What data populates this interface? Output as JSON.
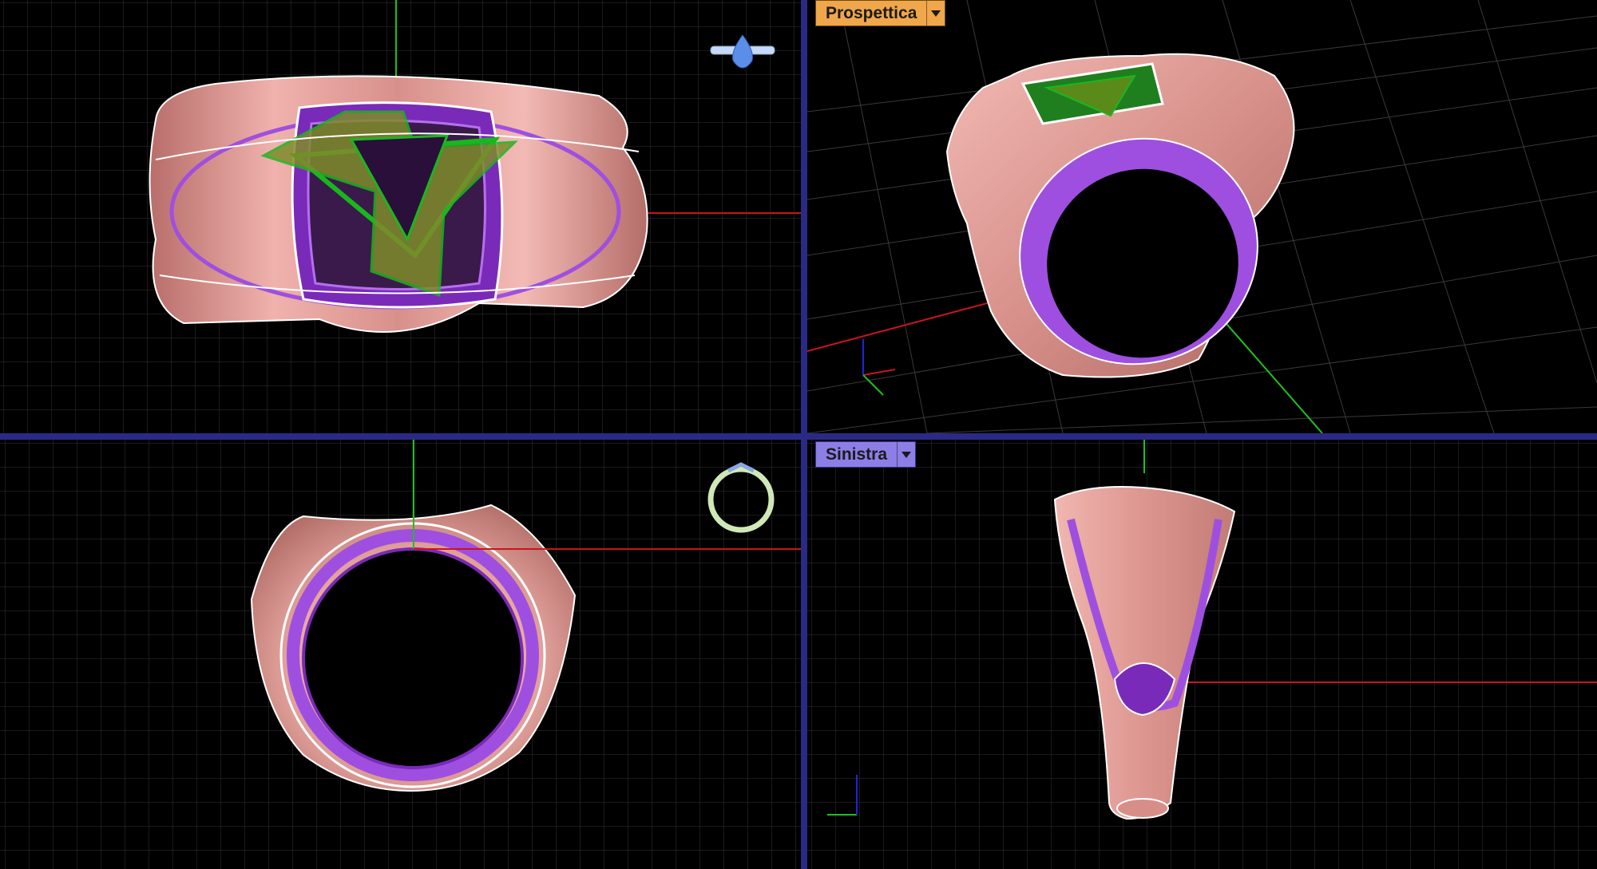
{
  "app": {
    "name": "Rhino 4-view viewport layout"
  },
  "viewports": {
    "top": {
      "title": "",
      "projection": "parallel"
    },
    "perspective": {
      "title": "Prospettica",
      "tab_color": "#f0a64a",
      "projection": "perspective"
    },
    "front": {
      "title": "",
      "projection": "parallel"
    },
    "left": {
      "title": "Sinistra",
      "tab_color": "#8b7fe6",
      "projection": "parallel"
    }
  },
  "colors": {
    "background": "#000000",
    "grid_minor": "#3a3a3a",
    "grid_major": "#5a5a5a",
    "x_axis": "#c8141e",
    "y_axis": "#1fbf1f",
    "z_axis": "#2222dd",
    "ring_metal": "#e2a09a",
    "inner_band": "#9f4fe0",
    "star_inlay": "#7f8b2a",
    "star_outline": "#19b71e",
    "curve_outline": "#ffffff",
    "divider": "#2a2a86"
  },
  "icons": {
    "viewport_menu": "triangle-down-icon",
    "preview_top": "pear-gem-ring-icon",
    "preview_front": "solitaire-ring-icon"
  }
}
